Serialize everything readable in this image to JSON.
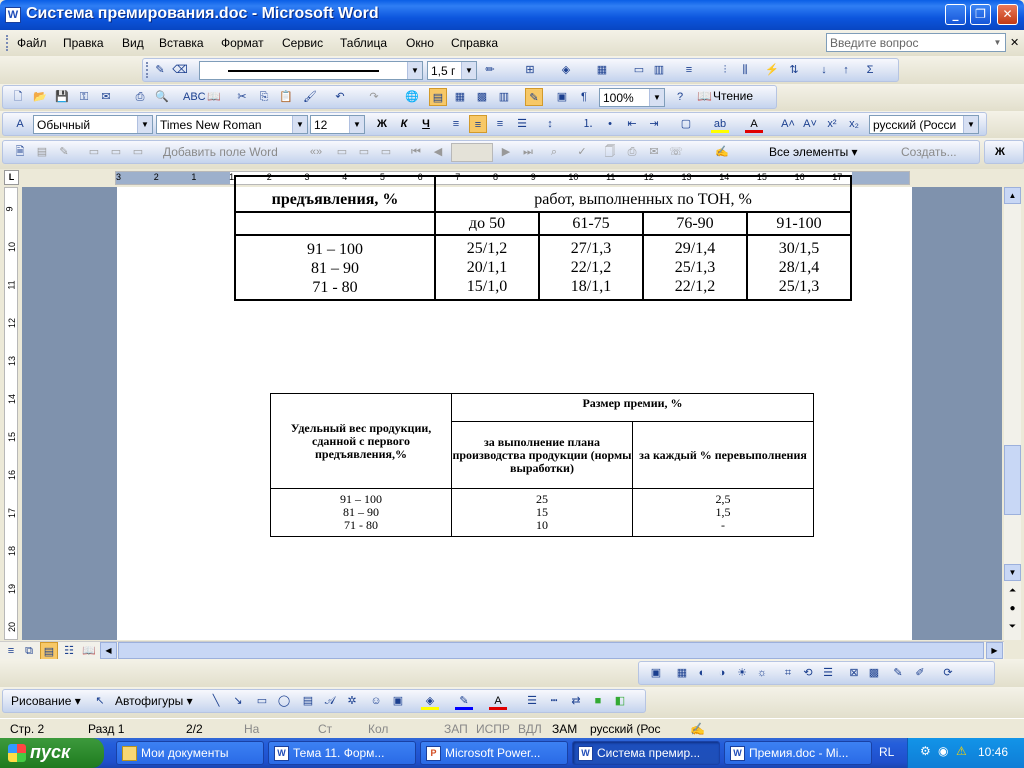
{
  "window": {
    "title": "Система премирования.doc - Microsoft Word"
  },
  "menu": {
    "items": [
      "Файл",
      "Правка",
      "Вид",
      "Вставка",
      "Формат",
      "Сервис",
      "Таблица",
      "Окно",
      "Справка"
    ],
    "help_placeholder": "Введите вопрос"
  },
  "toolbar_line": {
    "width_value": "1,5 г"
  },
  "standard": {
    "zoom": "100%",
    "read_label": "Чтение"
  },
  "formatting": {
    "style": "Обычный",
    "font": "Times New Roman",
    "size": "12",
    "bold": "Ж",
    "italic": "К",
    "underline": "Ч",
    "language": "русский (Росси"
  },
  "mailmerge": {
    "add_field": "Добавить поле Word",
    "all_elements": "Все элементы",
    "create": "Создать..."
  },
  "ruler": {
    "labels": [
      "3",
      "2",
      "1",
      "1",
      "2",
      "3",
      "4",
      "5",
      "6",
      "7",
      "8",
      "9",
      "10",
      "11",
      "12",
      "13",
      "14",
      "15",
      "16",
      "17"
    ],
    "vlabels": [
      "9",
      "10",
      "11",
      "12",
      "13",
      "14",
      "15",
      "16",
      "17",
      "18",
      "19",
      "20"
    ]
  },
  "table1": {
    "header_left": "предъявления, %",
    "header_top": "работ, выполненных по ТОН, %",
    "sub": [
      "до 50",
      "61-75",
      "76-90",
      "91-100"
    ],
    "rows": [
      [
        "91 – 100",
        "25/1,2",
        "27/1,3",
        "29/1,4",
        "30/1,5"
      ],
      [
        "81 – 90",
        "20/1,1",
        "22/1,2",
        "25/1,3",
        "28/1,4"
      ],
      [
        "71 - 80",
        "15/1,0",
        "18/1,1",
        "22/1,2",
        "25/1,3"
      ]
    ]
  },
  "table2": {
    "h_left": "Удельный вес продукции, сданной с первого предъявления,%",
    "h_top": "Размер премии, %",
    "h_col1": "за выполнение плана производства продукции (нормы выработки)",
    "h_col2": "за каждый % перевыполнения",
    "rows": [
      [
        "91 – 100",
        "25",
        "2,5"
      ],
      [
        "81 – 90",
        "15",
        "1,5"
      ],
      [
        "71 - 80",
        "10",
        "-"
      ]
    ]
  },
  "drawing": {
    "draw": "Рисование",
    "autoshapes": "Автофигуры"
  },
  "status": {
    "page": "Стр.  2",
    "section": "Разд  1",
    "pages": "2/2",
    "at": "На",
    "line": "Ст",
    "col": "Кол",
    "rec": "ЗАП",
    "trk": "ИСПР",
    "ext": "ВДЛ",
    "ovr": "ЗАМ",
    "lang": "русский (Рос"
  },
  "taskbar": {
    "start": "пуск",
    "tasks": [
      "Мои документы",
      "Тема 11. Форм...",
      "Microsoft Power...",
      "Система премир...",
      "Премия.doc - Mi..."
    ],
    "lang": "RL",
    "clock": "10:46"
  }
}
